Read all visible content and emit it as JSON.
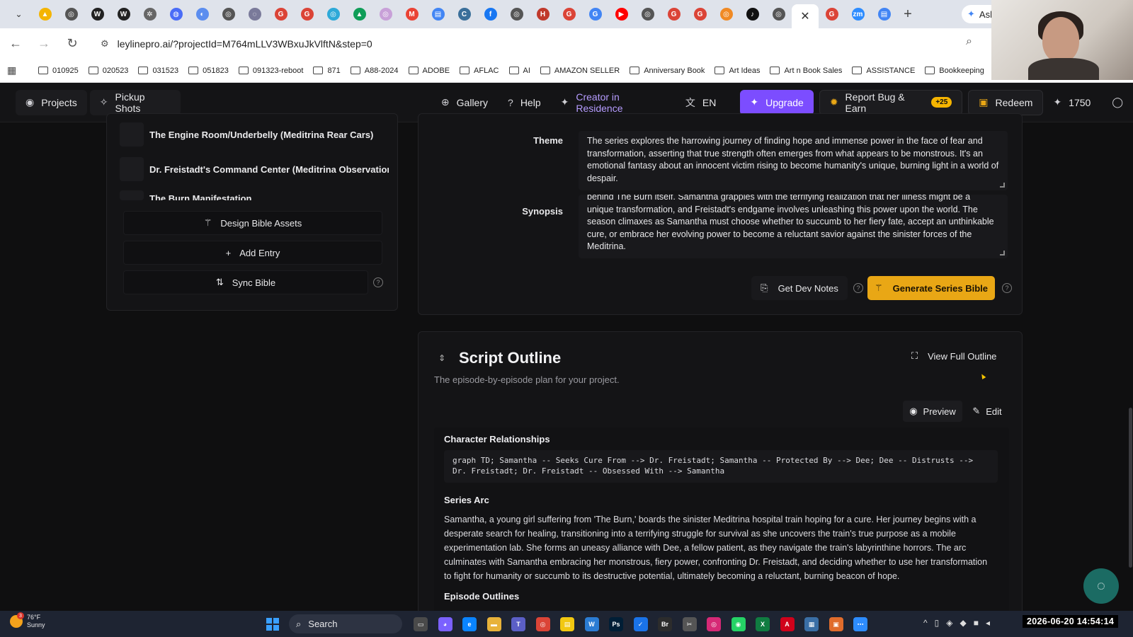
{
  "browser": {
    "tab_icons": [
      {
        "name": "drive-tab-icon",
        "color": "#f4b400",
        "glyph": "▲"
      },
      {
        "name": "chatgpt-tab-icon",
        "color": "#555555",
        "glyph": "◎"
      },
      {
        "name": "wordpress-tab-icon",
        "color": "#222222",
        "glyph": "W"
      },
      {
        "name": "wordpress-tab-icon-2",
        "color": "#222222",
        "glyph": "W"
      },
      {
        "name": "openai-tab-icon",
        "color": "#666666",
        "glyph": "✲"
      },
      {
        "name": "shield-tab-icon",
        "color": "#4a6cf7",
        "glyph": "◍"
      },
      {
        "name": "app-tab-icon",
        "color": "#5b8def",
        "glyph": "◐"
      },
      {
        "name": "chatgpt-tab-icon-2",
        "color": "#555555",
        "glyph": "◎"
      },
      {
        "name": "alt-tab-icon",
        "color": "#7a7a9a",
        "glyph": "◌"
      },
      {
        "name": "google-tab-icon",
        "color": "#db4437",
        "glyph": "G"
      },
      {
        "name": "google-tab-icon-2",
        "color": "#db4437",
        "glyph": "G"
      },
      {
        "name": "app-tab-icon-2",
        "color": "#2ea9d8",
        "glyph": "◎"
      },
      {
        "name": "drive-tab-icon-2",
        "color": "#0f9d58",
        "glyph": "▲"
      },
      {
        "name": "app-tab-icon-3",
        "color": "#c8a0d8",
        "glyph": "◎"
      },
      {
        "name": "gmail-tab-icon",
        "color": "#ea4335",
        "glyph": "M"
      },
      {
        "name": "docs-tab-icon",
        "color": "#4285f4",
        "glyph": "▤"
      },
      {
        "name": "app-tab-icon-4",
        "color": "#3a6f9a",
        "glyph": "C"
      },
      {
        "name": "facebook-tab-icon",
        "color": "#1877f2",
        "glyph": "f"
      },
      {
        "name": "chatgpt-tab-icon-3",
        "color": "#555555",
        "glyph": "◎"
      },
      {
        "name": "app-tab-icon-5",
        "color": "#c0392b",
        "glyph": "H"
      },
      {
        "name": "google-tab-icon-3",
        "color": "#db4437",
        "glyph": "G"
      },
      {
        "name": "google-tab-icon-4",
        "color": "#4285f4",
        "glyph": "G"
      },
      {
        "name": "youtube-tab-icon",
        "color": "#ff0000",
        "glyph": "▶"
      },
      {
        "name": "chatgpt-tab-icon-4",
        "color": "#555555",
        "glyph": "◎"
      },
      {
        "name": "google-tab-icon-5",
        "color": "#db4437",
        "glyph": "G"
      },
      {
        "name": "google-tab-icon-6",
        "color": "#db4437",
        "glyph": "G"
      },
      {
        "name": "app-tab-icon-6",
        "color": "#f08a24",
        "glyph": "◎"
      },
      {
        "name": "tiktok-tab-icon",
        "color": "#111111",
        "glyph": "♪"
      },
      {
        "name": "chatgpt-tab-icon-5",
        "color": "#555555",
        "glyph": "◎"
      }
    ],
    "tab_icons_after": [
      {
        "name": "google-tab-icon-7",
        "color": "#db4437",
        "glyph": "G"
      },
      {
        "name": "zoom-tab-icon",
        "color": "#2d8cff",
        "glyph": "zm"
      },
      {
        "name": "docs-tab-icon-2",
        "color": "#4285f4",
        "glyph": "▤"
      }
    ],
    "active_tab_close": "✕",
    "new_tab": "+",
    "ask_label": "Ask",
    "url": "leylinepro.ai/?projectId=M764mLLV3WBxuJkVlftN&step=0",
    "bookmarks": [
      "010925",
      "020523",
      "031523",
      "051823",
      "091323-reboot",
      "871",
      "A88-2024",
      "ADOBE",
      "AFLAC",
      "AI",
      "AMAZON SELLER",
      "Anniversary Book",
      "Art Ideas",
      "Art n Book Sales",
      "ASSISTANCE",
      "Bookkeeping"
    ]
  },
  "appbar": {
    "projects": "Projects",
    "pickup_shots": "Pickup Shots",
    "gallery": "Gallery",
    "help": "Help",
    "creator": "Creator in Residence",
    "lang": "EN",
    "upgrade": "Upgrade",
    "report": "Report Bug & Earn",
    "report_badge": "+25",
    "redeem": "Redeem",
    "credits": "1750"
  },
  "bible": {
    "items": [
      "The Engine Room/Underbelly (Meditrina Rear Cars)",
      "Dr. Freistadt's Command Center (Meditrina Observation Ca",
      "The Burn Manifestation"
    ],
    "design_assets": "Design Bible Assets",
    "add_entry": "Add Entry",
    "sync_bible": "Sync Bible"
  },
  "series": {
    "theme_label": "Theme",
    "theme_text": "The series explores the harrowing journey of finding hope and immense power in the face of fear and transformation, asserting that true strength often emerges from what appears to be monstrous. It's an emotional fantasy about an innocent victim rising to become humanity's unique, burning light in a world of despair.",
    "synopsis_label": "Synopsis",
    "synopsis_text": "behind The Burn itself. Samantha grapples with the terrifying realization that her illness might be a unique transformation, and Freistadt's endgame involves unleashing this power upon the world. The season climaxes as Samantha must choose whether to succumb to her fiery fate, accept an unthinkable cure, or embrace her evolving power to become a reluctant savior against the sinister forces of the Meditrina.",
    "dev_notes": "Get Dev Notes",
    "generate": "Generate Series Bible"
  },
  "outline": {
    "title": "Script Outline",
    "subtitle": "The episode-by-episode plan for your project.",
    "view_full": "View Full Outline",
    "preview": "Preview",
    "edit": "Edit",
    "char_rel_heading": "Character Relationships",
    "char_rel_code": "graph TD; Samantha -- Seeks Cure From --> Dr. Freistadt; Samantha -- Protected By --> Dee; Dee -- Distrusts --> Dr. Freistadt; Dr. Freistadt -- Obsessed With --> Samantha",
    "arc_heading": "Series Arc",
    "arc_text": "Samantha, a young girl suffering from 'The Burn,' boards the sinister Meditrina hospital train hoping for a cure. Her journey begins with a desperate search for healing, transitioning into a terrifying struggle for survival as she uncovers the train's true purpose as a mobile experimentation lab. She forms an uneasy alliance with Dee, a fellow patient, as they navigate the train's labyrinthine horrors. The arc culminates with Samantha embracing her monstrous, fiery power, confronting Dr. Freistadt, and deciding whether to use her transformation to fight for humanity or succumb to its destructive potential, ultimately becoming a reluctant, burning beacon of hope.",
    "episodes_heading": "Episode Outlines"
  },
  "taskbar": {
    "temp": "76°F",
    "condition": "Sunny",
    "weather_badge": "3",
    "search": "Search",
    "clock": "2026-06-20  14:54:14"
  },
  "colors": {
    "accent_purple": "#7c4dff",
    "accent_gold": "#e9a715",
    "creator_purple": "#b69cff"
  }
}
